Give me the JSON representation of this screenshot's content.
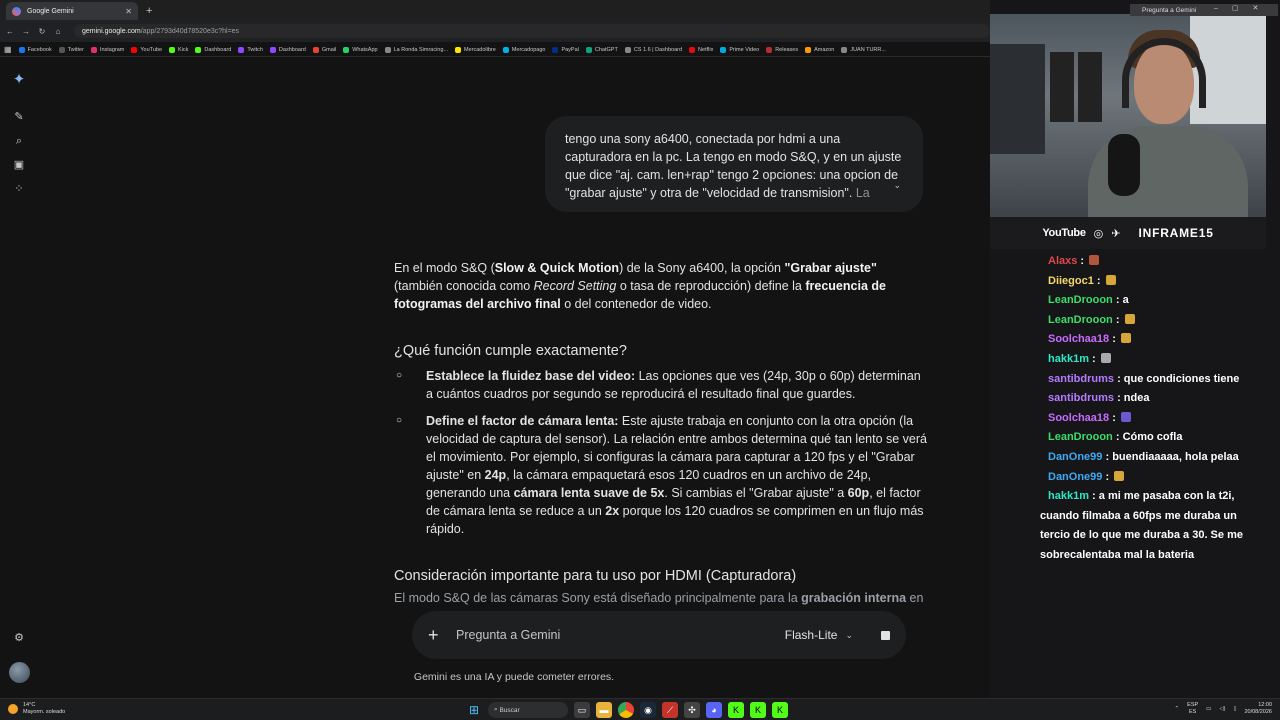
{
  "browser": {
    "tab_title": "Google Gemini",
    "url_host": "gemini.google.com",
    "url_path": "/app/2793d40d78520e3c?hl=es",
    "bookmarks": [
      "Facebook",
      "Twitter",
      "Instagram",
      "YouTube",
      "Kick",
      "Dashboard",
      "Twitch",
      "Dashboard",
      "Gmail",
      "WhatsApp",
      "La Ronda Simracing...",
      "Mercadolibre",
      "Mercadopago",
      "PayPal",
      "ChatGPT",
      "CS 1.6 | Dashboard",
      "Netflix",
      "Prime Video",
      "Releases",
      "Amazon",
      "JUAN TURR..."
    ]
  },
  "chat": {
    "user_message": "tengo una sony a6400, conectada por hdmi a una capturadora en la pc. La tengo en modo S&Q, y en un ajuste que dice \"aj. cam. len+rap\" tengo 2 opciones: una opcion de \"grabar ajuste\" y otra de \"velocidad de transmision\".",
    "user_message_fade": "La",
    "intro_1": "En el modo S&Q (",
    "intro_b1": "Slow & Quick Motion",
    "intro_2": ") de la Sony a6400, la opción ",
    "intro_b2": "\"Grabar ajuste\"",
    "intro_3": " (también conocida como ",
    "intro_i1": "Record Setting",
    "intro_4": " o tasa de reproducción) define la ",
    "intro_b3": "frecuencia de fotogramas del archivo final",
    "intro_5": " o del contenedor de video.",
    "heading_1": "¿Qué función cumple exactamente?",
    "b1_bold": "Establece la fluidez base del video:",
    "b1_text": " Las opciones que ves (24p, 30p o 60p) determinan a cuántos cuadros por segundo se reproducirá el resultado final que guardes.",
    "b2_bold": "Define el factor de cámara lenta:",
    "b2_t1": " Este ajuste trabaja en conjunto con la otra opción (la velocidad de captura del sensor). La relación entre ambos determina qué tan lento se verá el movimiento. Por ejemplo, si configuras la cámara para capturar a 120 fps y el \"Grabar ajuste\" en ",
    "b2_b1": "24p",
    "b2_t2": ", la cámara empaquetará esos 120 cuadros en un archivo de 24p, generando una ",
    "b2_b2": "cámara lenta suave de 5x",
    "b2_t3": ". Si cambias el \"Grabar ajuste\" a ",
    "b2_b3": "60p",
    "b2_t4": ", el factor de cámara lenta se reduce a un ",
    "b2_b4": "2x",
    "b2_t5": " porque los 120 cuadros se comprimen en un flujo más rápido.",
    "heading_2": "Consideración importante para tu uso por HDMI (Capturadora)",
    "cutoff_1": "El modo S&Q de las cámaras Sony está diseñado principalmente para la ",
    "cutoff_b": "grabación interna",
    "cutoff_2": " en",
    "input_placeholder": "Pregunta a Gemini",
    "model": "Flash-Lite",
    "disclaimer": "Gemini es una IA y puede cometer errores."
  },
  "stream": {
    "popup_title": "Pregunta a Gemini",
    "youtube": "YouTube",
    "brand": "INFRAME15",
    "chat": [
      {
        "user": "Alaxs",
        "color": "#e0474c",
        "msg": ""
      },
      {
        "user": "Diiegoc1",
        "color": "#f5d76e",
        "msg": ""
      },
      {
        "user": "LeanDrooon",
        "color": "#3ddc6b",
        "msg": "a"
      },
      {
        "user": "LeanDrooon",
        "color": "#3ddc6b",
        "msg": ""
      },
      {
        "user": "Soolchaa18",
        "color": "#c86bff",
        "msg": ""
      },
      {
        "user": "hakk1m",
        "color": "#2ee8c5",
        "msg": ""
      },
      {
        "user": "santibdrums",
        "color": "#b57bff",
        "msg": "que condiciones tiene"
      },
      {
        "user": "santibdrums",
        "color": "#b57bff",
        "msg": "ndea"
      },
      {
        "user": "Soolchaa18",
        "color": "#c86bff",
        "msg": ""
      },
      {
        "user": "LeanDrooon",
        "color": "#3ddc6b",
        "msg": "Cómo cofla"
      },
      {
        "user": "DanOne99",
        "color": "#3fa9f5",
        "msg": "buendiaaaaa, hola pelaa"
      },
      {
        "user": "DanOne99",
        "color": "#3fa9f5",
        "msg": ""
      }
    ],
    "last_user": "hakk1m",
    "last_msg_1": "a mi me pasaba con la t2i,",
    "last_msg_2": "cuando filmaba a 60fps me duraba un",
    "last_msg_3": "tercio de lo que me duraba a 30. Se me",
    "last_msg_4": "sobrecalentaba mal la bateria"
  },
  "taskbar": {
    "temp": "14°C",
    "weather": "Mayorm. soleado",
    "search": "Buscar",
    "lang1": "ESP",
    "lang2": "ES",
    "time": "12:00",
    "date": "20/08/2026"
  }
}
